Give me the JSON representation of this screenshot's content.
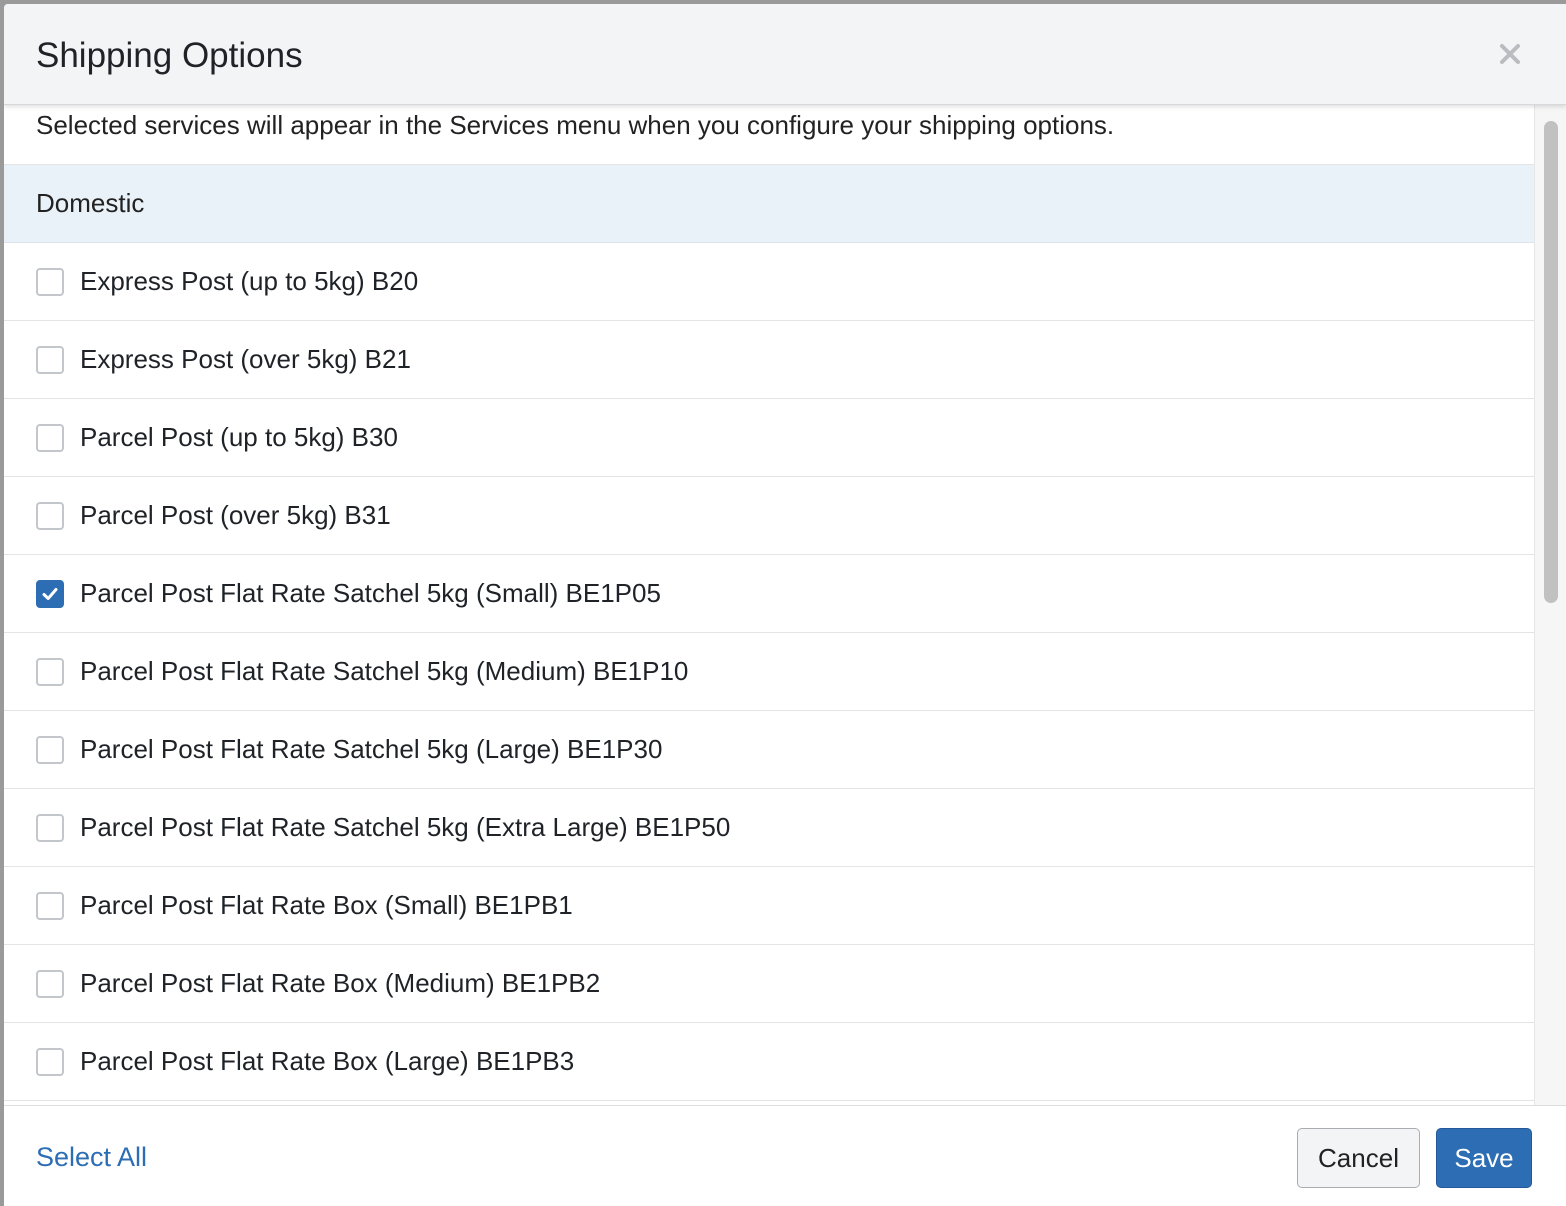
{
  "dialog": {
    "title": "Shipping Options",
    "close_icon": "close-icon",
    "intro": "Selected services will appear in the Services menu when you configure your shipping options."
  },
  "section": {
    "label": "Domestic"
  },
  "services": [
    {
      "label": "Express Post (up to 5kg) B20",
      "checked": false
    },
    {
      "label": "Express Post (over 5kg) B21",
      "checked": false
    },
    {
      "label": "Parcel Post (up to 5kg) B30",
      "checked": false
    },
    {
      "label": "Parcel Post (over 5kg) B31",
      "checked": false
    },
    {
      "label": "Parcel Post Flat Rate Satchel 5kg (Small) BE1P05",
      "checked": true
    },
    {
      "label": "Parcel Post Flat Rate Satchel 5kg (Medium) BE1P10",
      "checked": false
    },
    {
      "label": "Parcel Post Flat Rate Satchel 5kg (Large) BE1P30",
      "checked": false
    },
    {
      "label": "Parcel Post Flat Rate Satchel 5kg (Extra Large) BE1P50",
      "checked": false
    },
    {
      "label": "Parcel Post Flat Rate Box (Small) BE1PB1",
      "checked": false
    },
    {
      "label": "Parcel Post Flat Rate Box (Medium) BE1PB2",
      "checked": false
    },
    {
      "label": "Parcel Post Flat Rate Box (Large) BE1PB3",
      "checked": false
    }
  ],
  "footer": {
    "select_all": "Select All",
    "cancel": "Cancel",
    "save": "Save"
  },
  "colors": {
    "accent": "#2d6db4",
    "section_bg": "#eaf2f9",
    "header_bg": "#f3f4f5"
  }
}
